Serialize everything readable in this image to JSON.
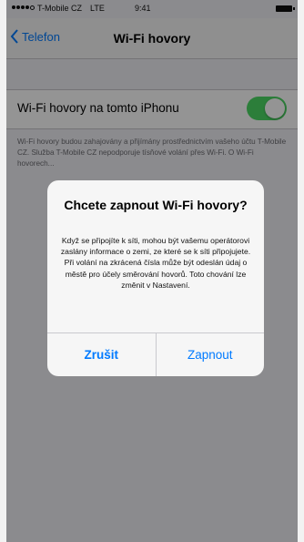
{
  "status_bar": {
    "carrier": "T-Mobile CZ",
    "network": "LTE",
    "time": "9:41"
  },
  "nav": {
    "back_label": "Telefon",
    "title": "Wi-Fi hovory"
  },
  "settings": {
    "row_label": "Wi-Fi hovory na tomto iPhonu",
    "toggle_on": true,
    "footnote": "Wi-Fi hovory budou zahajovány a přijímány prostřednictvím vašeho účtu T-Mobile CZ. Služba T-Mobile CZ nepodporuje tísňové volání přes Wi-Fi. O Wi-Fi hovorech..."
  },
  "alert": {
    "title": "Chcete zapnout Wi-Fi hovory?",
    "message": "Když se připojíte k síti, mohou být vašemu operátorovi zaslány informace o zemi, ze které se k síti připojujete. Při volání na zkrácená čísla může být odeslán údaj o městě pro účely směrování hovorů. Toto chování lze změnit v Nastavení.",
    "cancel_label": "Zrušit",
    "confirm_label": "Zapnout"
  },
  "colors": {
    "accent": "#007aff",
    "toggle_on": "#4cd964"
  }
}
